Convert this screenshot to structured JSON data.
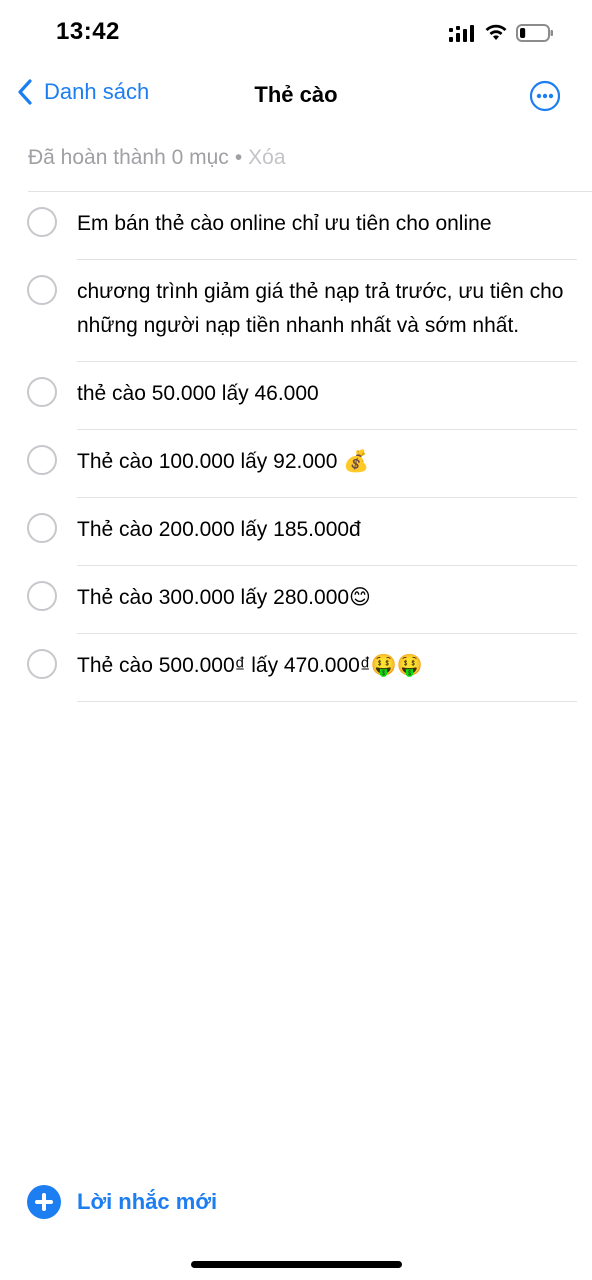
{
  "status_bar": {
    "time": "13:42",
    "battery_level": 0.2
  },
  "nav": {
    "back_label": "Danh sách",
    "title": "Thẻ cào"
  },
  "summary": {
    "completed_text": "Đã hoàn thành 0 mục",
    "separator": "•",
    "clear_label": "Xóa"
  },
  "reminders": [
    {
      "text": "Em bán thẻ cào online chỉ ưu tiên cho online",
      "completed": false
    },
    {
      "text": "chương trình giảm giá thẻ nạp trả trước, ưu tiên cho những người nạp tiền nhanh nhất và sớm nhất.",
      "completed": false
    },
    {
      "text": "thẻ cào 50.000 lấy 46.000",
      "completed": false
    },
    {
      "text": "Thẻ cào 100.000 lấy 92.000 💰",
      "completed": false
    },
    {
      "text": "Thẻ cào 200.000 lấy 185.000đ",
      "completed": false
    },
    {
      "text": "Thẻ cào 300.000 lấy 280.000😊",
      "completed": false
    },
    {
      "text": "Thẻ cào 500.000₫ lấy 470.000₫🤑🤑",
      "completed": false
    }
  ],
  "footer": {
    "new_reminder_label": "Lời nhắc mới"
  },
  "colors": {
    "accent": "#1c7ef0",
    "secondary_text": "#a0a0a4",
    "separator": "#e2e2e6",
    "circle": "#c7c7cc"
  }
}
